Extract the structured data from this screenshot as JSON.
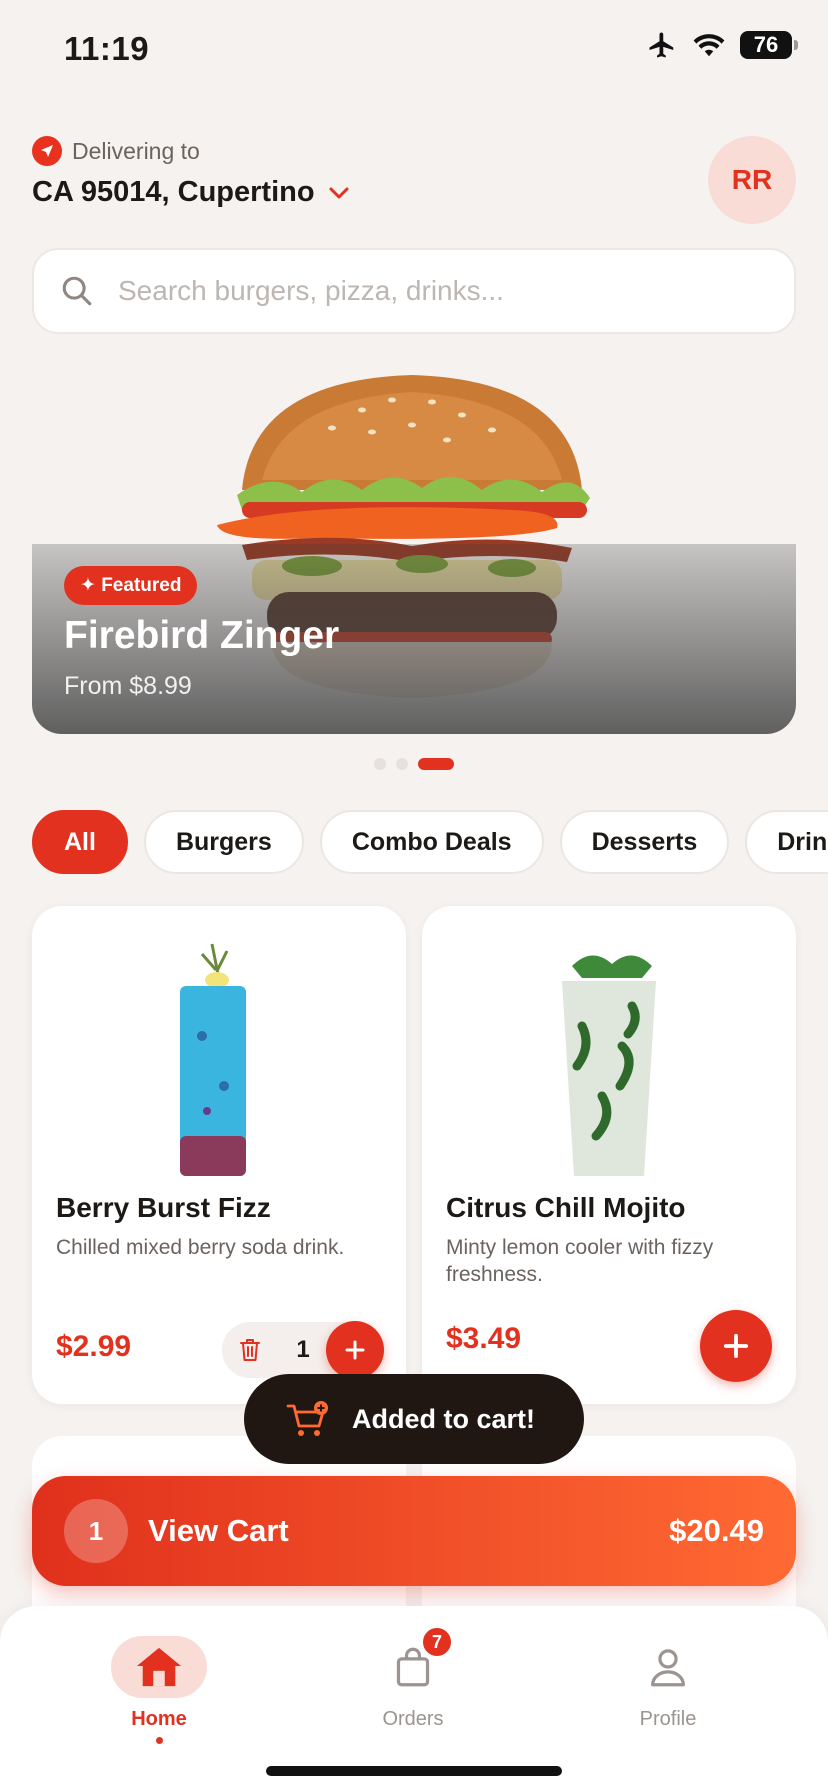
{
  "status": {
    "time": "11:19",
    "battery": "76"
  },
  "header": {
    "delivering_label": "Delivering to",
    "location": "CA 95014, Cupertino",
    "avatar_initials": "RR"
  },
  "search": {
    "placeholder": "Search burgers, pizza, drinks..."
  },
  "hero": {
    "badge": "✦ Featured",
    "title": "Firebird Zinger",
    "price": "From $8.99",
    "slides": 3,
    "active_slide": 3
  },
  "categories": [
    {
      "label": "All",
      "active": true
    },
    {
      "label": "Burgers"
    },
    {
      "label": "Combo Deals"
    },
    {
      "label": "Desserts"
    },
    {
      "label": "Drinks"
    }
  ],
  "products": [
    {
      "name": "Berry Burst Fizz",
      "description": "Chilled mixed berry soda drink.",
      "price": "$2.99",
      "quantity": "1"
    },
    {
      "name": "Citrus Chill Mojito",
      "description": "Minty lemon cooler with fizzy freshness.",
      "price": "$3.49"
    }
  ],
  "toast": {
    "message": "Added to cart!"
  },
  "cart": {
    "count": "1",
    "label": "View Cart",
    "total": "$20.49"
  },
  "tabs": [
    {
      "label": "Home",
      "icon": "home-icon",
      "active": true
    },
    {
      "label": "Orders",
      "icon": "bag-icon",
      "badge": "7"
    },
    {
      "label": "Profile",
      "icon": "person-icon"
    }
  ],
  "colors": {
    "accent": "#e2311f",
    "accent_light": "#fadcd7",
    "background": "#f5f2f0",
    "toast": "#201712"
  }
}
